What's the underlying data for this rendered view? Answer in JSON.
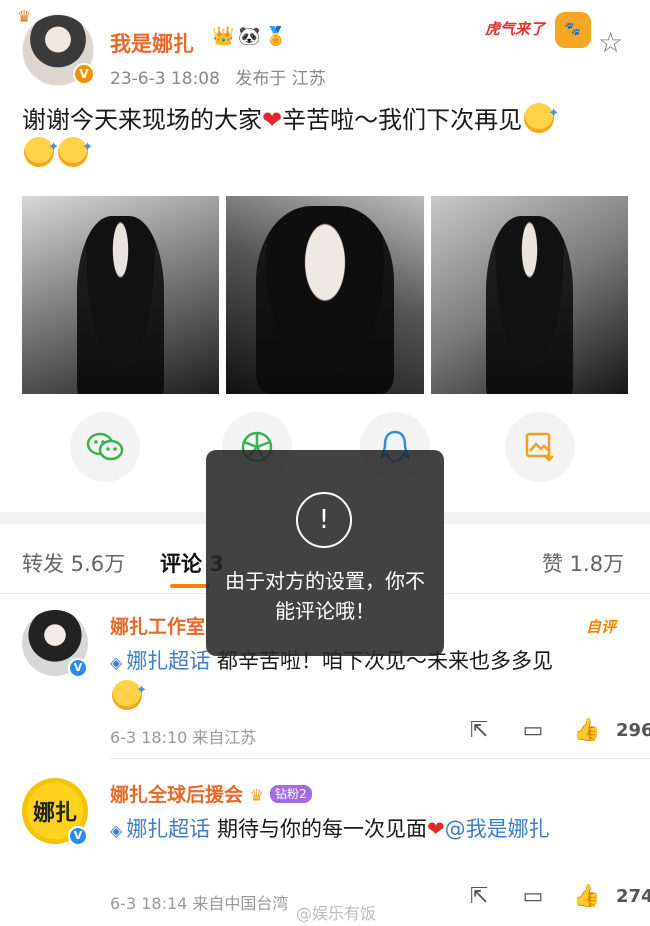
{
  "post": {
    "username": "我是娜扎",
    "badges": [
      "👑",
      "🐼",
      "🏅"
    ],
    "timestamp": "23-6-3 18:08",
    "source": "发布于 江苏",
    "banner_text": "虎气来了",
    "text_part1": "谢谢今天来现场的大家",
    "heart": "❤",
    "text_part2": "辛苦啦～我们下次再见"
  },
  "share": {
    "wechat_icon": "wechat-icon",
    "moments_icon": "moments-icon",
    "qq_icon": "qq-icon",
    "save_icon": "save-image-icon"
  },
  "tabs": {
    "repost": "转发 5.6万",
    "comment": "评论 3",
    "like": "赞 1.8万"
  },
  "comments": [
    {
      "name": "娜扎工作室",
      "tag": "自评",
      "topic": "娜扎超话",
      "text": " 都辛苦啦！咱下次见～未来也多多见",
      "meta": "6-3 18:10  来自江苏",
      "likes": "296"
    },
    {
      "name": "娜扎全球后援会",
      "fan_badge": "钻粉2",
      "avatar_text": "娜扎",
      "topic": "娜扎超话",
      "text": " 期待与你的每一次见面",
      "mention": "@我是娜扎",
      "meta": "6-3 18:14  来自中国台湾",
      "likes": "274"
    }
  ],
  "toast": {
    "message": "由于对方的设置，你不能评论哦！"
  },
  "watermark": "@娱乐有饭",
  "colors": {
    "accent": "#ff8200",
    "username": "#e8692a",
    "link": "#3d7ec7"
  }
}
